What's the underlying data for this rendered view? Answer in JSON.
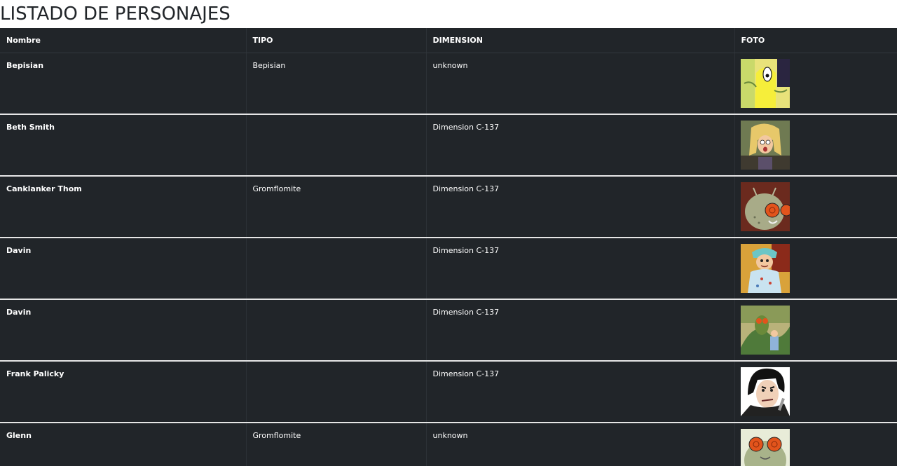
{
  "page": {
    "title": "LISTADO DE PERSONAJES"
  },
  "table": {
    "headers": [
      "Nombre",
      "TIPO",
      "DIMENSION",
      "FOTO"
    ],
    "rows": [
      {
        "name": "Bepisian",
        "type": "Bepisian",
        "dimension": "unknown",
        "photo": "bepisian-photo"
      },
      {
        "name": "Beth Smith",
        "type": "",
        "dimension": "Dimension C-137",
        "photo": "beth-smith-photo"
      },
      {
        "name": "Canklanker Thom",
        "type": "Gromflomite",
        "dimension": "Dimension C-137",
        "photo": "canklanker-thom-photo"
      },
      {
        "name": "Davin",
        "type": "",
        "dimension": "Dimension C-137",
        "photo": "davin-photo"
      },
      {
        "name": "Davin",
        "type": "",
        "dimension": "Dimension C-137",
        "photo": "davin-photo"
      },
      {
        "name": "Frank Palicky",
        "type": "",
        "dimension": "Dimension C-137",
        "photo": "frank-palicky-photo"
      },
      {
        "name": "Glenn",
        "type": "Gromflomite",
        "dimension": "unknown",
        "photo": "glenn-photo"
      }
    ]
  },
  "colors": {
    "table_bg": "#212529",
    "row_separator": "#e6e6e6",
    "title_text": "#212529"
  }
}
